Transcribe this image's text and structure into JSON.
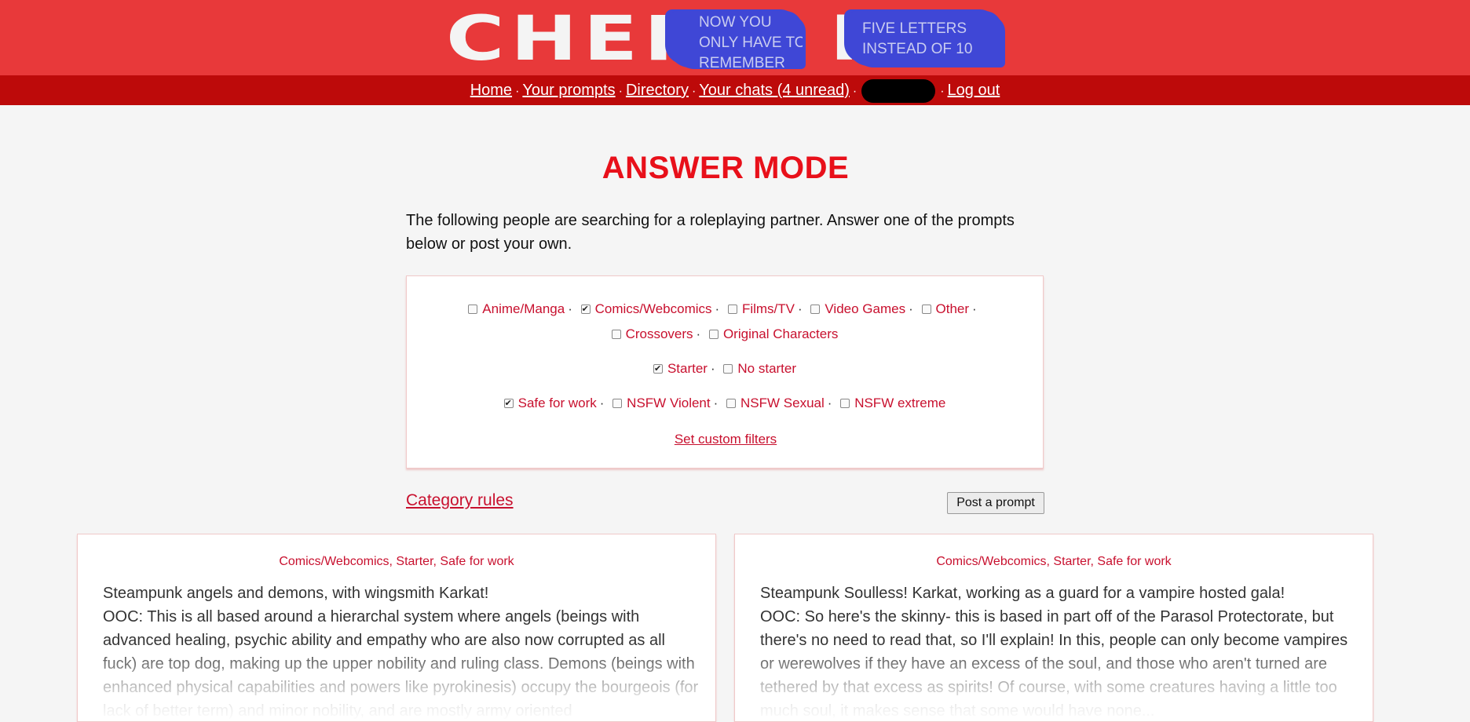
{
  "header": {
    "logo_text": "CHER",
    "logo_text_2": "P",
    "scribble_1": [
      "NOW YOU",
      "ONLY HAVE TO",
      "REMEMBER"
    ],
    "scribble_2": [
      "FIVE LETTERS",
      "INSTEAD OF 10"
    ]
  },
  "nav": {
    "home": "Home",
    "your_prompts": "Your prompts",
    "directory": "Directory",
    "your_chats": "Your chats (4 unread)",
    "log_out": "Log out",
    "separator": "·"
  },
  "main": {
    "title": "ANSWER MODE",
    "intro": "The following people are searching for a roleplaying partner. Answer one of the prompts below or post your own.",
    "category_rules": "Category rules",
    "post_prompt": "Post a prompt",
    "set_custom_filters": "Set custom filters"
  },
  "filters": {
    "categories": [
      {
        "label": "Anime/Manga",
        "checked": false
      },
      {
        "label": "Comics/Webcomics",
        "checked": true
      },
      {
        "label": "Films/TV",
        "checked": false
      },
      {
        "label": "Video Games",
        "checked": false
      },
      {
        "label": "Other",
        "checked": false
      },
      {
        "label": "Crossovers",
        "checked": false
      },
      {
        "label": "Original Characters",
        "checked": false
      }
    ],
    "starter": [
      {
        "label": "Starter",
        "checked": true
      },
      {
        "label": "No starter",
        "checked": false
      }
    ],
    "levels": [
      {
        "label": "Safe for work",
        "checked": true
      },
      {
        "label": "NSFW Violent",
        "checked": false
      },
      {
        "label": "NSFW Sexual",
        "checked": false
      },
      {
        "label": "NSFW extreme",
        "checked": false
      }
    ]
  },
  "prompts": [
    {
      "tags": "Comics/Webcomics, Starter, Safe for work",
      "title": "Steampunk angels and demons, with wingsmith Karkat!",
      "text": "OOC: This is all based around a hierarchal system where angels (beings with advanced healing, psychic ability and empathy who are also now corrupted as all fuck) are top dog, making up the upper nobility and ruling class. Demons (beings with enhanced physical capabilities and powers like pyrokinesis) occupy the bourgeois (for lack of better term) and minor nobility, and are mostly army oriented"
    },
    {
      "tags": "Comics/Webcomics, Starter, Safe for work",
      "title": "Steampunk Soulless! Karkat, working as a guard for a vampire hosted gala!",
      "text": "OOC: So here's the skinny- this is based in part off of the Parasol Protectorate, but there's no need to read that, so I'll explain! In this, people can only become vampires or werewolves if they have an excess of the soul, and those who aren't turned are tethered by that excess as spirits! Of course, with some creatures having a little too much soul, it makes sense that some would have none..."
    }
  ]
}
